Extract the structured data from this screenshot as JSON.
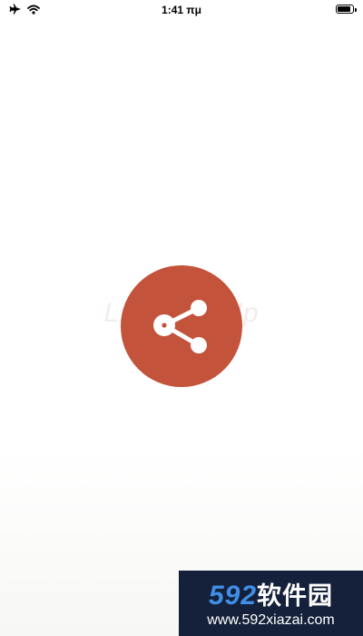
{
  "status_bar": {
    "time": "1:41 πμ",
    "airplane_icon": "airplane-icon",
    "wifi_icon": "wifi-icon",
    "battery_icon": "battery-icon",
    "battery_level": 0.9
  },
  "splash": {
    "watermark_text": "LibreLinkUp",
    "logo_icon": "share-icon",
    "logo_color": "#c3533a"
  },
  "site_badge": {
    "number": "592",
    "chinese": "软件园",
    "url": "www.592xiazai.com",
    "number_color": "#3f8fe8",
    "background": "#15213a"
  }
}
